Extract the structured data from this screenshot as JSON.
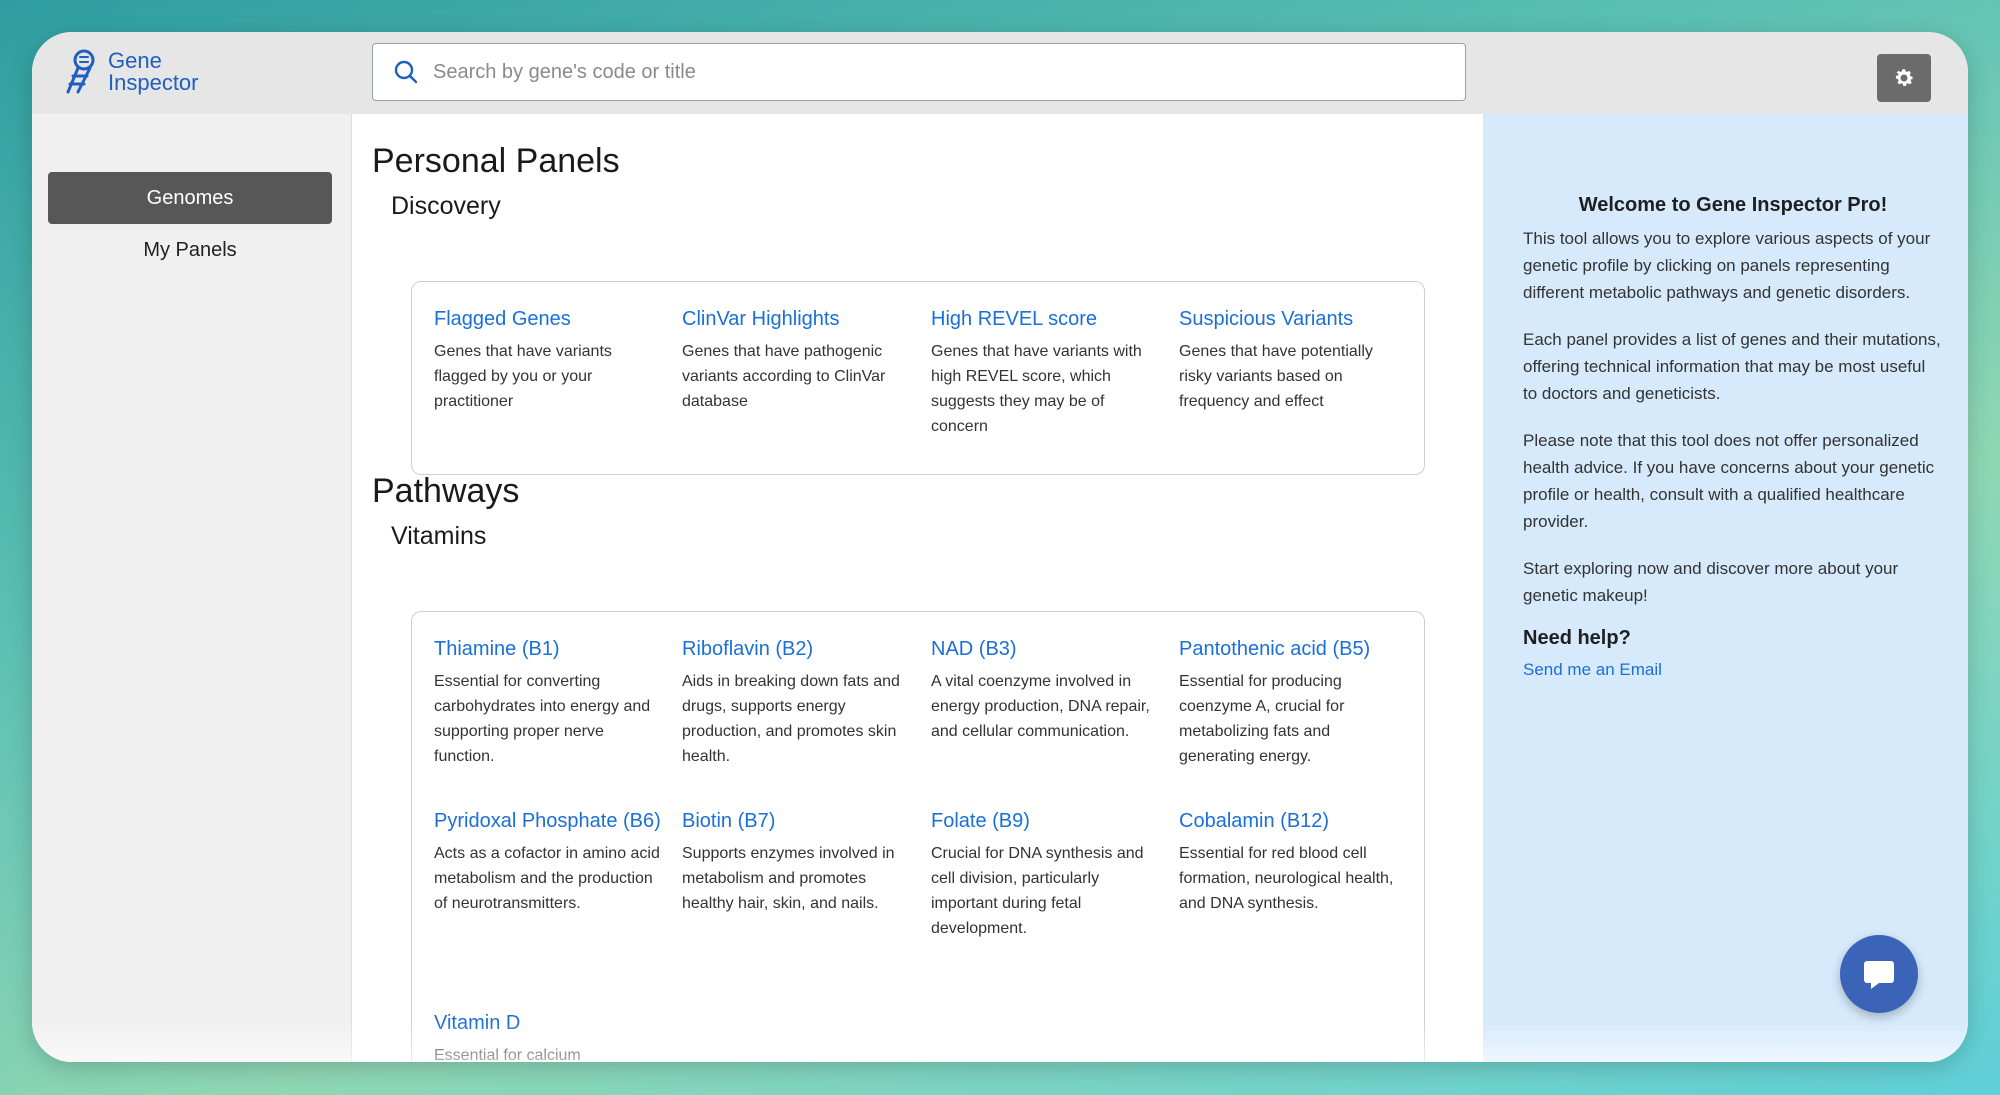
{
  "app": {
    "logo_line1": "Gene",
    "logo_line2": "Inspector"
  },
  "search": {
    "placeholder": "Search by gene's code or title"
  },
  "icons": {
    "logo": "dna-magnifier-icon",
    "search": "search-icon",
    "settings": "gear-icon",
    "chat": "chat-bubble-icon"
  },
  "colors": {
    "accent_link": "#1a6fd8",
    "sidebar_active": "#575757",
    "info_panel": "#d6eafc",
    "chat_button": "#3b64b8"
  },
  "sidebar": {
    "items": [
      {
        "label": "Genomes",
        "active": true
      },
      {
        "label": "My Panels",
        "active": false
      }
    ]
  },
  "main": {
    "section1_title": "Personal Panels",
    "section1_sub": "Discovery",
    "discovery": [
      {
        "title": "Flagged Genes",
        "desc": "Genes that have variants flagged by you or your practitioner"
      },
      {
        "title": "ClinVar Highlights",
        "desc": "Genes that have pathogenic variants according to ClinVar database"
      },
      {
        "title": "High REVEL score",
        "desc": "Genes that have variants with high REVEL score, which suggests they may be of concern"
      },
      {
        "title": "Suspicious Variants",
        "desc": "Genes that have potentially risky variants based on frequency and effect"
      }
    ],
    "section2_title": "Pathways",
    "section2_sub": "Vitamins",
    "vitamins": [
      {
        "title": "Thiamine (B1)",
        "desc": "Essential for converting carbohydrates into energy and supporting proper nerve function."
      },
      {
        "title": "Riboflavin (B2)",
        "desc": "Aids in breaking down fats and drugs, supports energy production, and promotes skin health."
      },
      {
        "title": "NAD (B3)",
        "desc": "A vital coenzyme involved in energy production, DNA repair, and cellular communication."
      },
      {
        "title": "Pantothenic acid (B5)",
        "desc": "Essential for producing coenzyme A, crucial for metabolizing fats and generating energy."
      },
      {
        "title": "Pyridoxal Phosphate (B6)",
        "desc": "Acts as a cofactor in amino acid metabolism and the production of neurotransmitters."
      },
      {
        "title": "Biotin (B7)",
        "desc": "Supports enzymes involved in metabolism and promotes healthy hair, skin, and nails."
      },
      {
        "title": "Folate (B9)",
        "desc": "Crucial for DNA synthesis and cell division, particularly important during fetal development."
      },
      {
        "title": "Cobalamin (B12)",
        "desc": "Essential for red blood cell formation, neurological health, and DNA synthesis."
      },
      {
        "title": "Vitamin D",
        "desc": "Essential for calcium absorption, bone health,"
      }
    ]
  },
  "info": {
    "title": "Welcome to Gene Inspector Pro!",
    "p1": "This tool allows you to explore various aspects of your genetic profile by clicking on panels representing different metabolic pathways and genetic disorders.",
    "p2": "Each panel provides a list of genes and their mutations, offering technical information that may be most useful to doctors and geneticists.",
    "p3": "Please note that this tool does not offer personalized health advice. If you have concerns about your genetic profile or health, consult with a qualified healthcare provider.",
    "p4": "Start exploring now and discover more about your genetic makeup!",
    "help_title": "Need help?",
    "help_link": "Send me an Email"
  }
}
